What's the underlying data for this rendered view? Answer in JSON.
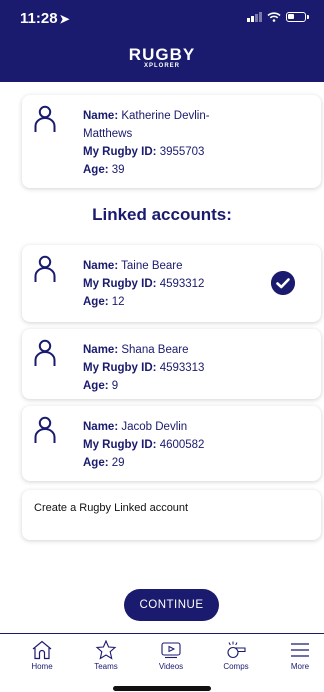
{
  "status_bar": {
    "time": "11:28",
    "location_glyph": "➤"
  },
  "app": {
    "logo_main": "RUGBY",
    "logo_sub": "XPLORER"
  },
  "labels": {
    "name": "Name:",
    "rugby_id": "My Rugby ID:",
    "age": "Age:"
  },
  "primary_account": {
    "name": "Katherine Devlin-Matthews",
    "rugby_id": "3955703",
    "age": "39"
  },
  "linked_title": "Linked accounts:",
  "linked_accounts": [
    {
      "name": "Taine Beare",
      "rugby_id": "4593312",
      "age": "12",
      "selected": true
    },
    {
      "name": "Shana Beare",
      "rugby_id": "4593313",
      "age": "9",
      "selected": false
    },
    {
      "name": "Jacob Devlin",
      "rugby_id": "4600582",
      "age": "29",
      "selected": false
    }
  ],
  "create_label": "Create a Rugby Linked account",
  "continue_label": "CONTINUE",
  "tabs": [
    {
      "label": "Home",
      "icon": "home-icon"
    },
    {
      "label": "Teams",
      "icon": "star-icon"
    },
    {
      "label": "Videos",
      "icon": "play-icon"
    },
    {
      "label": "Comps",
      "icon": "whistle-icon"
    },
    {
      "label": "More",
      "icon": "menu-icon"
    }
  ],
  "colors": {
    "brand_navy": "#1a1a6e"
  }
}
